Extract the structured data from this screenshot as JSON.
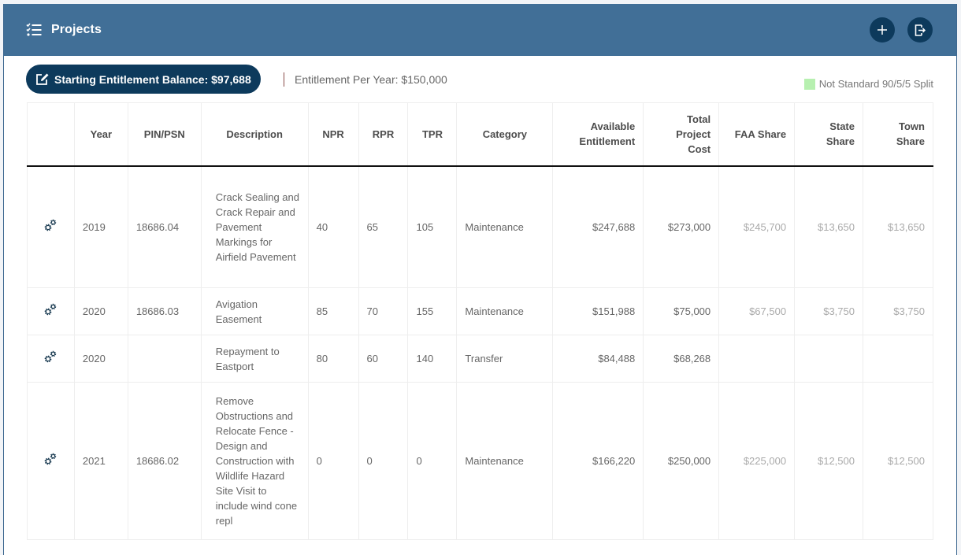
{
  "header": {
    "title": "Projects",
    "title_icon": "tasks-list-icon",
    "actions": [
      {
        "name": "add-project-button",
        "icon": "plus-icon"
      },
      {
        "name": "export-button",
        "icon": "export-icon"
      }
    ]
  },
  "toolbar": {
    "balance_label": "Starting Entitlement Balance: $97,688",
    "per_year_label": "Entitlement Per Year: $150,000",
    "legend_label": "Not Standard 90/5/5 Split",
    "legend_color": "#b7f0b0"
  },
  "colors": {
    "header_bg": "#416f97",
    "accent_dark": "#0d3a5c"
  },
  "table": {
    "columns": [
      "",
      "Year",
      "PIN/PSN",
      "Description",
      "NPR",
      "RPR",
      "TPR",
      "Category",
      "Available Entitlement",
      "Total Project Cost",
      "FAA Share",
      "State Share",
      "Town Share"
    ],
    "rows": [
      {
        "year": "2019",
        "pin": "18686.04",
        "description": "Crack Sealing and Crack Repair and Pavement Markings for Airfield Pavement",
        "npr": "40",
        "rpr": "65",
        "tpr": "105",
        "category": "Maintenance",
        "available": "$247,688",
        "total": "$273,000",
        "faa": "$245,700",
        "state": "$13,650",
        "town": "$13,650"
      },
      {
        "year": "2020",
        "pin": "18686.03",
        "description": "Avigation Easement",
        "npr": "85",
        "rpr": "70",
        "tpr": "155",
        "category": "Maintenance",
        "available": "$151,988",
        "total": "$75,000",
        "faa": "$67,500",
        "state": "$3,750",
        "town": "$3,750"
      },
      {
        "year": "2020",
        "pin": "",
        "description": "Repayment to Eastport",
        "npr": "80",
        "rpr": "60",
        "tpr": "140",
        "category": "Transfer",
        "available": "$84,488",
        "total": "$68,268",
        "faa": "",
        "state": "",
        "town": ""
      },
      {
        "year": "2021",
        "pin": "18686.02",
        "description": "Remove Obstructions and Relocate Fence - Design and Construction with Wildlife Hazard Site Visit to include wind cone repl",
        "npr": "0",
        "rpr": "0",
        "tpr": "0",
        "category": "Maintenance",
        "available": "$166,220",
        "total": "$250,000",
        "faa": "$225,000",
        "state": "$12,500",
        "town": "$12,500"
      }
    ]
  }
}
